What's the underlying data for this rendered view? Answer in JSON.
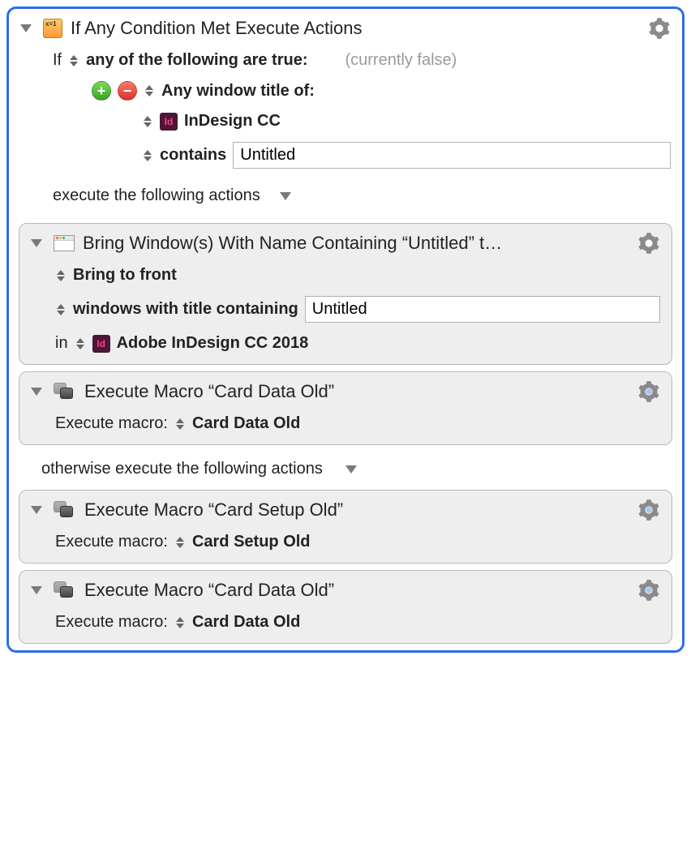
{
  "ifBlock": {
    "title": "If Any Condition Met Execute Actions",
    "ifWord": "If",
    "anyFollowing": "any of the following are true:",
    "currentState": "(currently false)",
    "anyWindowTitleOf": "Any window title of:",
    "appName": "InDesign CC",
    "contains": "contains",
    "containsValue": "Untitled",
    "executeFollowing": "execute the following actions"
  },
  "bringBlock": {
    "title": "Bring Window(s) With Name Containing “Untitled” t…",
    "bringFront": "Bring to front",
    "windowsWith": "windows with title containing",
    "windowsValue": "Untitled",
    "inWord": "in",
    "appFull": "Adobe InDesign CC 2018"
  },
  "macro1": {
    "title": "Execute Macro “Card Data Old”",
    "label": "Execute macro:",
    "name": "Card Data Old"
  },
  "otherwise": "otherwise execute the following actions",
  "macro2": {
    "title": "Execute Macro “Card Setup Old”",
    "label": "Execute macro:",
    "name": "Card Setup Old"
  },
  "macro3": {
    "title": "Execute Macro “Card Data Old”",
    "label": "Execute macro:",
    "name": "Card Data Old"
  }
}
